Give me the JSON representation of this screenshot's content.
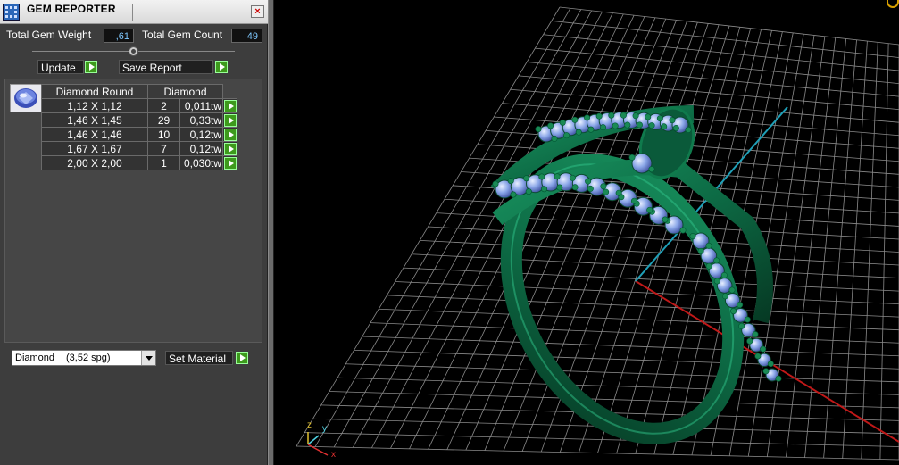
{
  "window": {
    "title": "GEM REPORTER",
    "close_glyph": "×"
  },
  "summary": {
    "weight_label": "Total Gem Weight",
    "weight_value": ",61",
    "count_label": "Total Gem Count",
    "count_value": "49"
  },
  "buttons": {
    "update": "Update",
    "save_report": "Save Report",
    "set_material": "Set Material"
  },
  "table": {
    "headers": [
      "Diamond Round",
      "Diamond"
    ],
    "rows": [
      {
        "size": "1,12 X 1,12",
        "count": "2",
        "weight": "0,011tw"
      },
      {
        "size": "1,46 X 1,45",
        "count": "29",
        "weight": "0,33tw"
      },
      {
        "size": "1,46 X 1,46",
        "count": "10",
        "weight": "0,12tw"
      },
      {
        "size": "1,67 X 1,67",
        "count": "7",
        "weight": "0,12tw"
      },
      {
        "size": "2,00 X 2,00",
        "count": "1",
        "weight": "0,030tw"
      }
    ]
  },
  "material": {
    "name": "Diamond",
    "sg": "(3,52 spg)"
  },
  "viewport": {
    "axis_z": "z",
    "axis_y": "y",
    "axis_x": "x"
  },
  "colors": {
    "metal": "#0d6b45",
    "gem": "#8aa6e8",
    "grid": "#8a8a8a",
    "x_axis": "#c01818",
    "y_axis": "#1fa0b8",
    "go_button": "#3d9a1c"
  },
  "icons": [
    "app-grid-icon",
    "close-icon",
    "slider-knob-icon",
    "play-arrow-icon",
    "gem-round-icon",
    "dropdown-arrow-icon",
    "axis-gizmo-icon",
    "view-ring-icon"
  ]
}
